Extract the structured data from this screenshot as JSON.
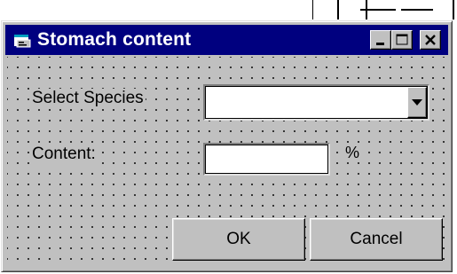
{
  "window": {
    "title": "Stomach content",
    "icon": "form-icon",
    "controls": {
      "minimize": "minimize-icon",
      "maximize": "maximize-icon",
      "close": "close-icon"
    }
  },
  "form": {
    "species_label": "Select Species",
    "species_value": "",
    "content_label": "Content:",
    "content_value": "",
    "percent_unit": "%"
  },
  "buttons": {
    "ok": "OK",
    "cancel": "Cancel"
  },
  "colors": {
    "titlebar": "#00007f",
    "face": "#c0c0c0"
  }
}
